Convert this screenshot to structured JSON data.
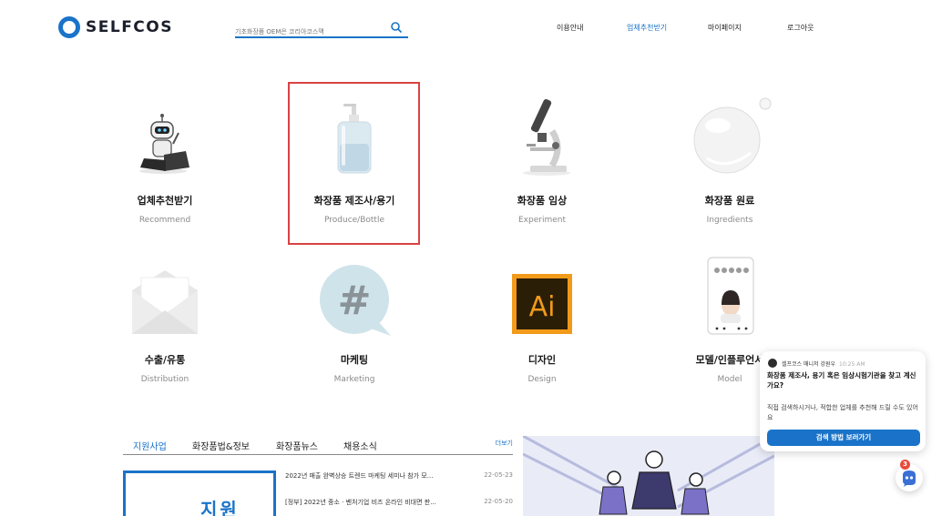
{
  "header": {
    "logo_text": "SELFCOS",
    "search_placeholder": "기초화장품 OEM은 코리아코스맥",
    "nav": [
      "이용안내",
      "업체추천받기",
      "마이페이지",
      "로그아웃"
    ],
    "active_nav_index": 1,
    "accent_color": "#1a73c9"
  },
  "categories": [
    {
      "title": "업체추천받기",
      "subtitle": "Recommend",
      "icon": "robot-laptop-icon"
    },
    {
      "title": "화장품 제조사/용기",
      "subtitle": "Produce/Bottle",
      "icon": "pump-bottle-icon",
      "selected": true
    },
    {
      "title": "화장품 임상",
      "subtitle": "Experiment",
      "icon": "microscope-icon"
    },
    {
      "title": "화장품 원료",
      "subtitle": "Ingredients",
      "icon": "droplet-icon"
    },
    {
      "title": "수출/유통",
      "subtitle": "Distribution",
      "icon": "envelope-icon"
    },
    {
      "title": "마케팅",
      "subtitle": "Marketing",
      "icon": "hashtag-icon"
    },
    {
      "title": "디자인",
      "subtitle": "Design",
      "icon": "illustrator-icon"
    },
    {
      "title": "모델/인플루언서",
      "subtitle": "Model",
      "icon": "phone-model-icon"
    }
  ],
  "ai_badge_text": "Ai",
  "hash_text": "#",
  "bottom": {
    "tabs": [
      "지원사업",
      "화장품법&정보",
      "화장품뉴스",
      "채용소식"
    ],
    "active_tab_index": 0,
    "more_label": "더보기",
    "news": [
      {
        "title": "2022년 매출 완벽상승 트렌드 마케팅 세미나 참가 모...",
        "date": "22-05-23"
      },
      {
        "title": "[정부] 2022년 중소 · 벤처기업 비즈 온라인 비대면 판...",
        "date": "22-05-20"
      }
    ],
    "banner_word": "지원"
  },
  "chat": {
    "sender": "셀프코스 매니저 강원우",
    "time": "10:25 AM",
    "question": "화장품 제조사, 용기 혹은 임상시험기관을 찾고 계신가요?",
    "description": "직접 검색하시거나, 적합한 업체를 추천해 드릴 수도 있어요",
    "button_label": "검색 방법 보러가기",
    "unread_count": "3"
  }
}
